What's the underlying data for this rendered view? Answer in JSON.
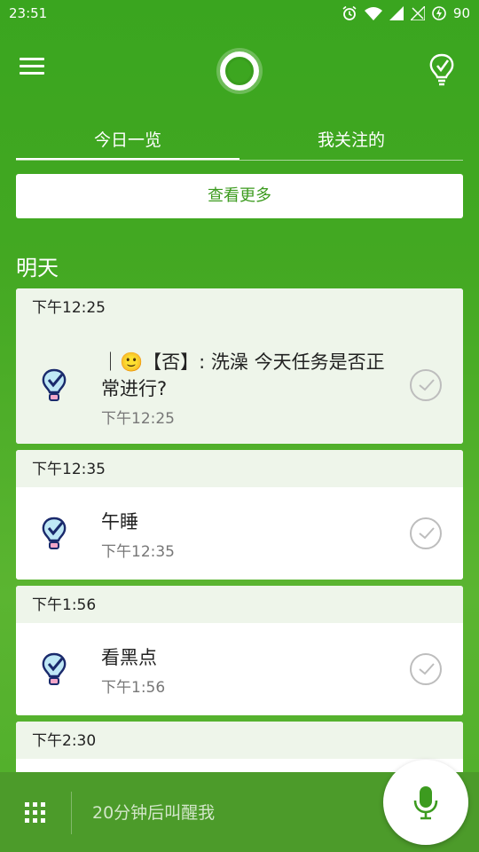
{
  "status_bar": {
    "time": "23:51",
    "battery": "90",
    "icons": [
      "alarm-icon",
      "wifi-icon",
      "signal-icon",
      "no-sim-icon",
      "battery-charging-icon"
    ]
  },
  "app_bar": {
    "icons": [
      "menu-icon",
      "cortana-icon",
      "bulb-check-icon"
    ]
  },
  "tabs": [
    {
      "label": "今日一览",
      "active": true
    },
    {
      "label": "我关注的",
      "active": false
    }
  ],
  "see_more_label": "查看更多",
  "section_title": "明天",
  "cards": [
    {
      "header_time": "下午12:25",
      "title": "｜🙂【否】: 洗澡  今天任务是否正常进行?",
      "time": "下午12:25"
    },
    {
      "header_time": "下午12:35",
      "title": "午睡",
      "time": "下午12:35"
    },
    {
      "header_time": "下午1:56",
      "title": "看黑点",
      "time": "下午1:56"
    },
    {
      "header_time": "下午2:30"
    }
  ],
  "bottom_bar": {
    "input_placeholder": "20分钟后叫醒我",
    "icons": [
      "grid-icon",
      "mic-icon"
    ]
  },
  "colors": {
    "brand_green": "#43a822",
    "link_green": "#3c9b1f",
    "card_header_bg": "#eef5ea"
  }
}
